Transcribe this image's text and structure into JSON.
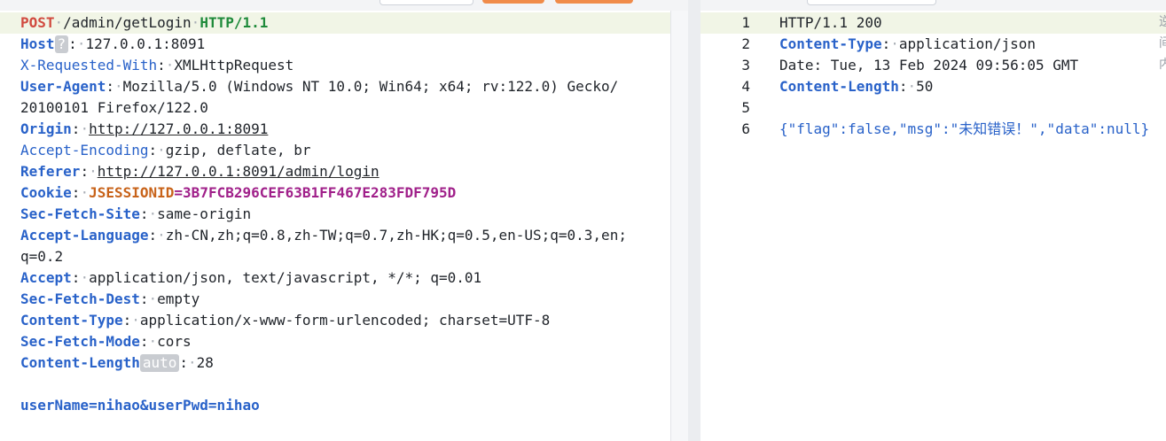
{
  "request": {
    "method": "POST",
    "path": "/admin/getLogin",
    "protocol": "HTTP/1.1",
    "headers": [
      {
        "name": "Host",
        "badge": "?",
        "value": "127.0.0.1:8091"
      },
      {
        "name": "X-Requested-With",
        "value": "XMLHttpRequest"
      },
      {
        "name": "User-Agent",
        "value": "Mozilla/5.0 (Windows NT 10.0; Win64; x64; rv:122.0) Gecko/",
        "wrap": "20100101 Firefox/122.0"
      },
      {
        "name": "Origin",
        "value": "http://127.0.0.1:8091"
      },
      {
        "name": "Accept-Encoding",
        "value": "gzip, deflate, br"
      },
      {
        "name": "Referer",
        "value": "http://127.0.0.1:8091/admin/login"
      },
      {
        "name": "Cookie",
        "cookie_name": "JSESSIONID",
        "cookie_value": "3B7FCB296CEF63B1FF467E283FDF795D"
      },
      {
        "name": "Sec-Fetch-Site",
        "value": "same-origin"
      },
      {
        "name": "Accept-Language",
        "value": "zh-CN,zh;q=0.8,zh-TW;q=0.7,zh-HK;q=0.5,en-US;q=0.3,en;",
        "wrap": "q=0.2"
      },
      {
        "name": "Accept",
        "value": "application/json, text/javascript, */*; q=0.01"
      },
      {
        "name": "Sec-Fetch-Dest",
        "value": "empty"
      },
      {
        "name": "Content-Type",
        "value": "application/x-www-form-urlencoded; charset=UTF-8"
      },
      {
        "name": "Sec-Fetch-Mode",
        "value": "cors"
      },
      {
        "name": "Content-Length",
        "badge": "auto",
        "value": "28"
      }
    ],
    "body": "userName=nihao&userPwd=nihao"
  },
  "response": {
    "lines": [
      {
        "num": "1",
        "text": "HTTP/1.1 200"
      },
      {
        "num": "2",
        "name": "Content-Type",
        "value": "application/json"
      },
      {
        "num": "3",
        "text": "Date: Tue, 13 Feb 2024 09:56:05 GMT"
      },
      {
        "num": "4",
        "name": "Content-Length",
        "value": "50"
      },
      {
        "num": "5",
        "text": ""
      },
      {
        "num": "6",
        "json": "{\"flag\":false,\"msg\":\"未知错误！\",\"data\":null}"
      }
    ]
  },
  "side_fragments": [
    "逆",
    "间",
    "内"
  ]
}
